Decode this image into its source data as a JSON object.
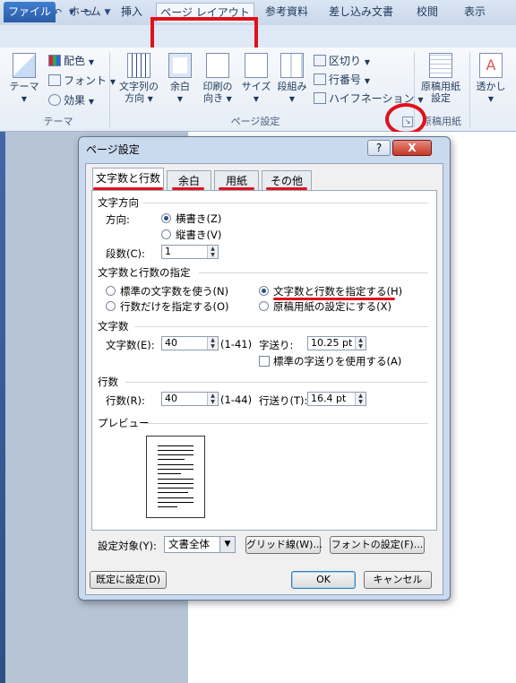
{
  "app": {
    "logo_letter": "W"
  },
  "tabs": [
    "ファイル",
    "ホーム",
    "挿入",
    "ページ レイアウト",
    "参考資料",
    "差し込み文書",
    "校閲",
    "表示"
  ],
  "ribbon": {
    "theme_group": {
      "label": "テーマ",
      "theme_button": "テーマ",
      "colors": "配色",
      "fonts": "フォント",
      "effects": "効果"
    },
    "page_setup_group": {
      "label": "ページ設定",
      "text_direction": [
        "文字列の",
        "方向"
      ],
      "margins": "余白",
      "orientation": [
        "印刷の",
        "向き"
      ],
      "size": "サイズ",
      "columns": "段組み",
      "breaks": "区切り",
      "line_numbers": "行番号",
      "hyphenation": "ハイフネーション"
    },
    "manuscript_group": {
      "label": "原稿用紙",
      "button": [
        "原稿用紙",
        "設定"
      ]
    },
    "watermark": "透かし"
  },
  "dialog": {
    "title": "ページ設定",
    "help": "?",
    "close": "X",
    "tabs": [
      "文字数と行数",
      "余白",
      "用紙",
      "その他"
    ],
    "direction": {
      "section": "文字方向",
      "direction_label": "方向:",
      "horizontal": "横書き(Z)",
      "vertical": "縦書き(V)",
      "columns_label": "段数(C):",
      "columns_value": "1"
    },
    "grid": {
      "section": "文字数と行数の指定",
      "opt_standard": "標準の文字数を使う(N)",
      "opt_lines_only": "行数だけを指定する(O)",
      "opt_chars_lines": "文字数と行数を指定する(H)",
      "opt_manuscript": "原稿用紙の設定にする(X)"
    },
    "chars": {
      "section": "文字数",
      "count_label": "文字数(E):",
      "count_value": "40",
      "count_range": "(1-41)",
      "pitch_label": "字送り:",
      "pitch_value": "10.25 pt",
      "use_standard": "標準の字送りを使用する(A)"
    },
    "lines": {
      "section": "行数",
      "count_label": "行数(R):",
      "count_value": "40",
      "count_range": "(1-44)",
      "pitch_label": "行送り(T):",
      "pitch_value": "16.4 pt"
    },
    "preview": {
      "section": "プレビュー"
    },
    "apply_label": "設定対象(Y):",
    "apply_value": "文書全体",
    "grid_button": "グリッド線(W)...",
    "font_button": "フォントの設定(F)...",
    "default_button": "既定に設定(D)",
    "ok": "OK",
    "cancel": "キャンセル"
  }
}
